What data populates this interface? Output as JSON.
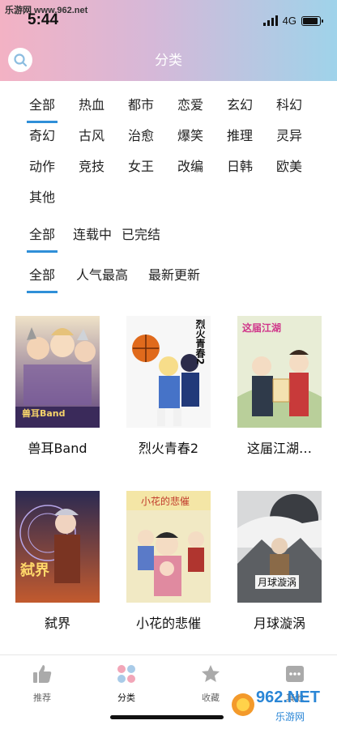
{
  "watermark": "乐游网 www.962.net",
  "status_bar": {
    "time": "5:44",
    "network": "4G",
    "battery_level": 0.9
  },
  "header": {
    "title": "分类",
    "search_icon": "search-icon"
  },
  "filters": {
    "genres": [
      "全部",
      "热血",
      "都市",
      "恋爱",
      "玄幻",
      "科幻",
      "奇幻",
      "古风",
      "治愈",
      "爆笑",
      "推理",
      "灵异",
      "动作",
      "竞技",
      "女王",
      "改编",
      "日韩",
      "欧美",
      "其他"
    ],
    "genre_selected": "全部",
    "status": [
      "全部",
      "连载中",
      "已完结"
    ],
    "status_selected": "全部",
    "sort": [
      "全部",
      "人气最高",
      "最新更新"
    ],
    "sort_selected": "全部"
  },
  "comics": [
    {
      "title": "兽耳Band",
      "cover_text": "兽耳Band",
      "cover_colors": [
        "#6b5a8c",
        "#e7c9a8"
      ]
    },
    {
      "title": "烈火青春2",
      "cover_text": "烈火青春2",
      "cover_colors": [
        "#ffffff",
        "#2d4fa8"
      ]
    },
    {
      "title": "这届江湖…",
      "cover_text": "这届江湖",
      "cover_colors": [
        "#e9efd2",
        "#c83a3a"
      ]
    },
    {
      "title": "弑界",
      "cover_text": "弑界",
      "cover_colors": [
        "#4b3d7a",
        "#d86a3a"
      ]
    },
    {
      "title": "小花的悲催",
      "cover_text": "小花的悲催",
      "cover_colors": [
        "#f4e6a6",
        "#e08aa0"
      ]
    },
    {
      "title": "月球漩涡",
      "cover_text": "月球漩涡",
      "cover_colors": [
        "#1f2328",
        "#8b8e94"
      ]
    }
  ],
  "tabbar": {
    "items": [
      {
        "label": "推荐",
        "icon": "thumbs-up-icon"
      },
      {
        "label": "分类",
        "icon": "category-grid-icon"
      },
      {
        "label": "收藏",
        "icon": "star-icon"
      },
      {
        "label": "其他",
        "icon": "more-icon"
      }
    ],
    "active": "分类"
  },
  "brand_logo": {
    "text": "962.NET",
    "subtext": "乐游网"
  }
}
